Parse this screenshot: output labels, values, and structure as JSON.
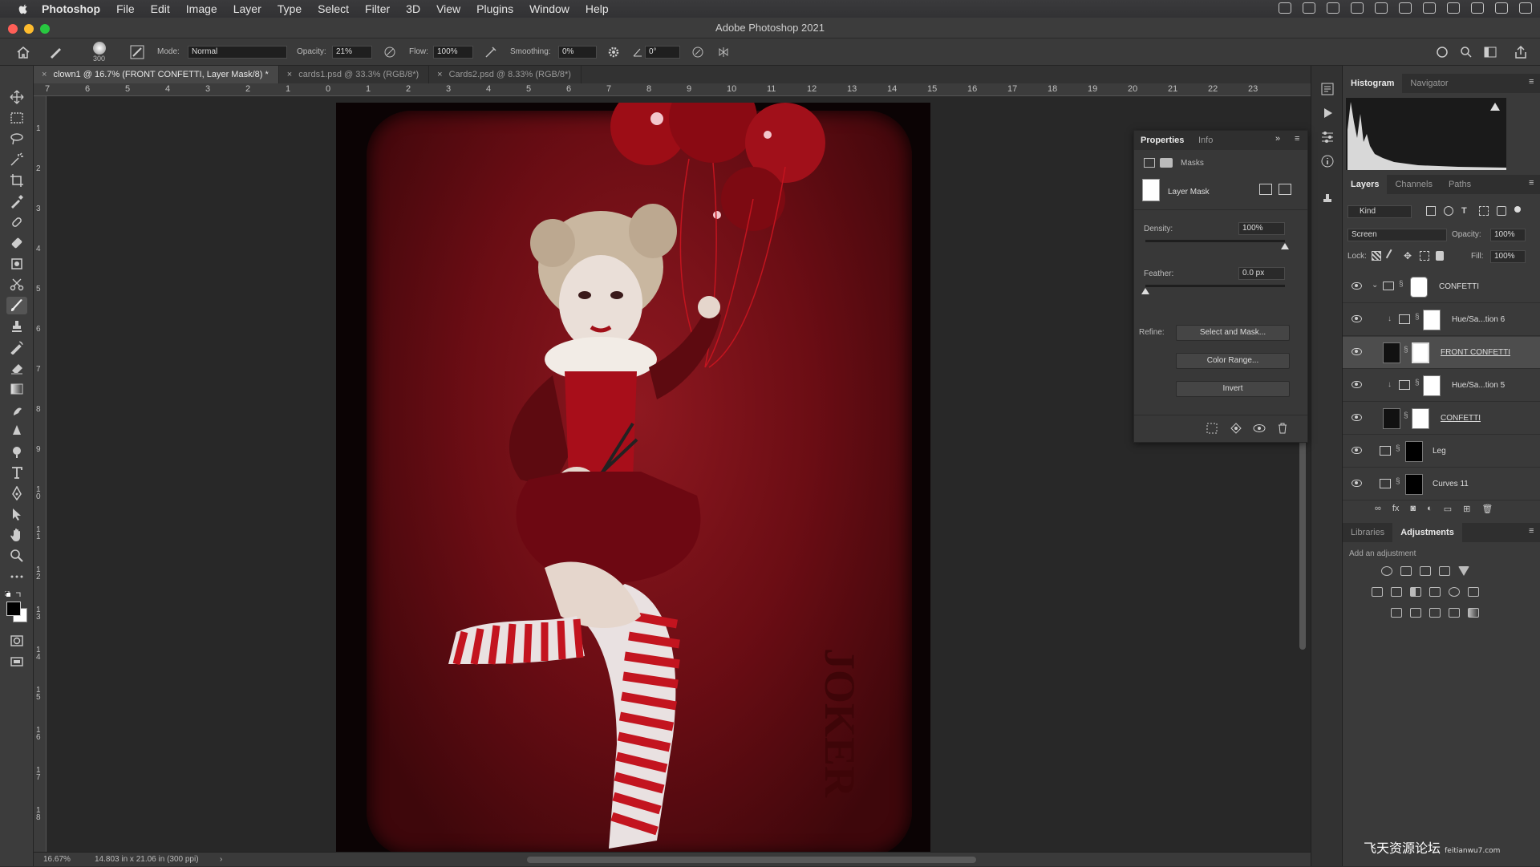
{
  "menubar": {
    "app": "Photoshop",
    "items": [
      "File",
      "Edit",
      "Image",
      "Layer",
      "Type",
      "Select",
      "Filter",
      "3D",
      "View",
      "Plugins",
      "Window",
      "Help"
    ]
  },
  "window": {
    "title": "Adobe Photoshop 2021"
  },
  "options": {
    "brush_size": "300",
    "mode_label": "Mode:",
    "mode_value": "Normal",
    "opacity_label": "Opacity:",
    "opacity_value": "21%",
    "flow_label": "Flow:",
    "flow_value": "100%",
    "smoothing_label": "Smoothing:",
    "smoothing_value": "0%",
    "angle_value": "0°"
  },
  "tabs": [
    {
      "label": "clown1 @ 16.7% (FRONT CONFETTI, Layer Mask/8) *"
    },
    {
      "label": "cards1.psd @ 33.3% (RGB/8*)"
    },
    {
      "label": "Cards2.psd @ 8.33% (RGB/8*)"
    }
  ],
  "ruler": {
    "h": [
      "7",
      "6",
      "5",
      "4",
      "3",
      "2",
      "1",
      "0",
      "1",
      "2",
      "3",
      "4",
      "5",
      "6",
      "7",
      "8",
      "9",
      "10",
      "11",
      "12",
      "13",
      "14",
      "15",
      "16",
      "17",
      "18",
      "19",
      "20",
      "21",
      "22",
      "23"
    ],
    "v": [
      "1",
      "2",
      "3",
      "4",
      "5",
      "6",
      "7",
      "8",
      "9",
      "1\n0",
      "1\n1",
      "1\n2",
      "1\n3",
      "1\n4",
      "1\n5",
      "1\n6",
      "1\n7",
      "1\n8"
    ]
  },
  "artwork": {
    "card_text": "JOKER"
  },
  "status": {
    "zoom": "16.67%",
    "info": "14.803 in x 21.06 in (300 ppi)"
  },
  "properties": {
    "tabs": [
      "Properties",
      "Info"
    ],
    "section": "Masks",
    "mask_type": "Layer Mask",
    "density_label": "Density:",
    "density_value": "100%",
    "density_fraction": 1.0,
    "feather_label": "Feather:",
    "feather_value": "0.0 px",
    "refine_label": "Refine:",
    "buttons": [
      "Select and Mask...",
      "Color Range...",
      "Invert"
    ]
  },
  "histogram": {
    "tabs": [
      "Histogram",
      "Navigator"
    ]
  },
  "layers_panel": {
    "tabs": [
      "Layers",
      "Channels",
      "Paths"
    ],
    "kind": "Kind",
    "blend": "Screen",
    "opacity_label": "Opacity:",
    "opacity_value": "100%",
    "lock_label": "Lock:",
    "fill_label": "Fill:",
    "fill_value": "100%",
    "layers": [
      {
        "name": "CONFETTI",
        "type": "group",
        "selected": false
      },
      {
        "name": "Hue/Sa...tion 6",
        "type": "adjustment",
        "selected": false
      },
      {
        "name": "FRONT CONFETTI",
        "type": "pixel",
        "selected": true
      },
      {
        "name": "Hue/Sa...tion 5",
        "type": "adjustment",
        "selected": false
      },
      {
        "name": "CONFETTI",
        "type": "pixel",
        "selected": false
      },
      {
        "name": "Leg",
        "type": "adjustment",
        "selected": false
      },
      {
        "name": "Curves 11",
        "type": "adjustment",
        "selected": false
      }
    ]
  },
  "adjustments_panel": {
    "tabs": [
      "Libraries",
      "Adjustments"
    ],
    "hint": "Add an adjustment"
  },
  "watermark": {
    "text": "飞天资源论坛",
    "sub": "feitianwu7.com"
  },
  "colors": {
    "accent": "#1473e6",
    "card_red": "#7a1018"
  }
}
